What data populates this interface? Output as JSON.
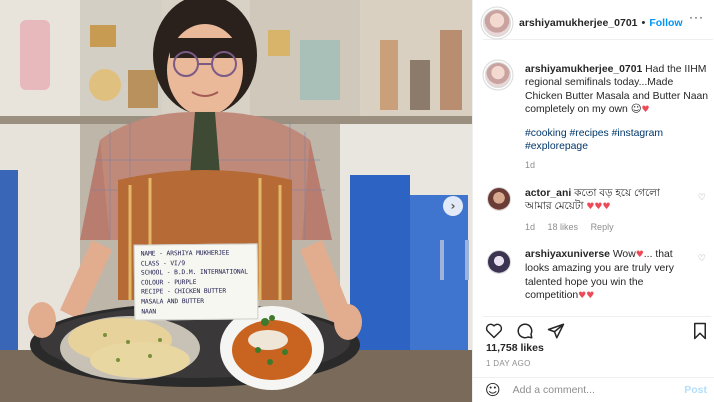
{
  "header": {
    "username": "arshiyamukherjee_0701",
    "separator": "•",
    "follow_label": "Follow",
    "more_icon": "···"
  },
  "caption": {
    "username": "arshiyamukherjee_0701",
    "text": "Had the IIHM regional semifinals today...Made Chicken Butter Masala and Butter Naan completely on my own",
    "hashtags": "#cooking #recipes #instagram #explorepage",
    "age": "1d"
  },
  "comments": [
    {
      "username": "actor_ani",
      "text": "কতো বড় হয়ে গেলো আমার মেয়েটা",
      "age": "1d",
      "likes": "18 likes",
      "reply": "Reply"
    },
    {
      "username": "arshiyaxuniverse",
      "text": "Wow",
      "text2": "... that looks amazing you are truly very talented hope you win the competition"
    }
  ],
  "footer": {
    "likes": "11,758 likes",
    "time_ago": "1 DAY AGO",
    "comment_placeholder": "Add a comment...",
    "post_label": "Post"
  },
  "photo": {
    "card_lines": [
      "NAME - ARSHIYA MUKHERJEE",
      "CLASS - VI/9",
      "SCHOOL - B.D.M. INTERNATIONAL",
      "COLOUR - PURPLE",
      "RECIPE - CHICKEN BUTTER",
      "MASALA AND BUTTER",
      "NAAN"
    ],
    "next_icon": "chevron-right-icon"
  },
  "colors": {
    "follow": "#0095f6",
    "hashtag": "#00376b",
    "heart": "#ed4956",
    "muted": "#8e8e8e"
  }
}
